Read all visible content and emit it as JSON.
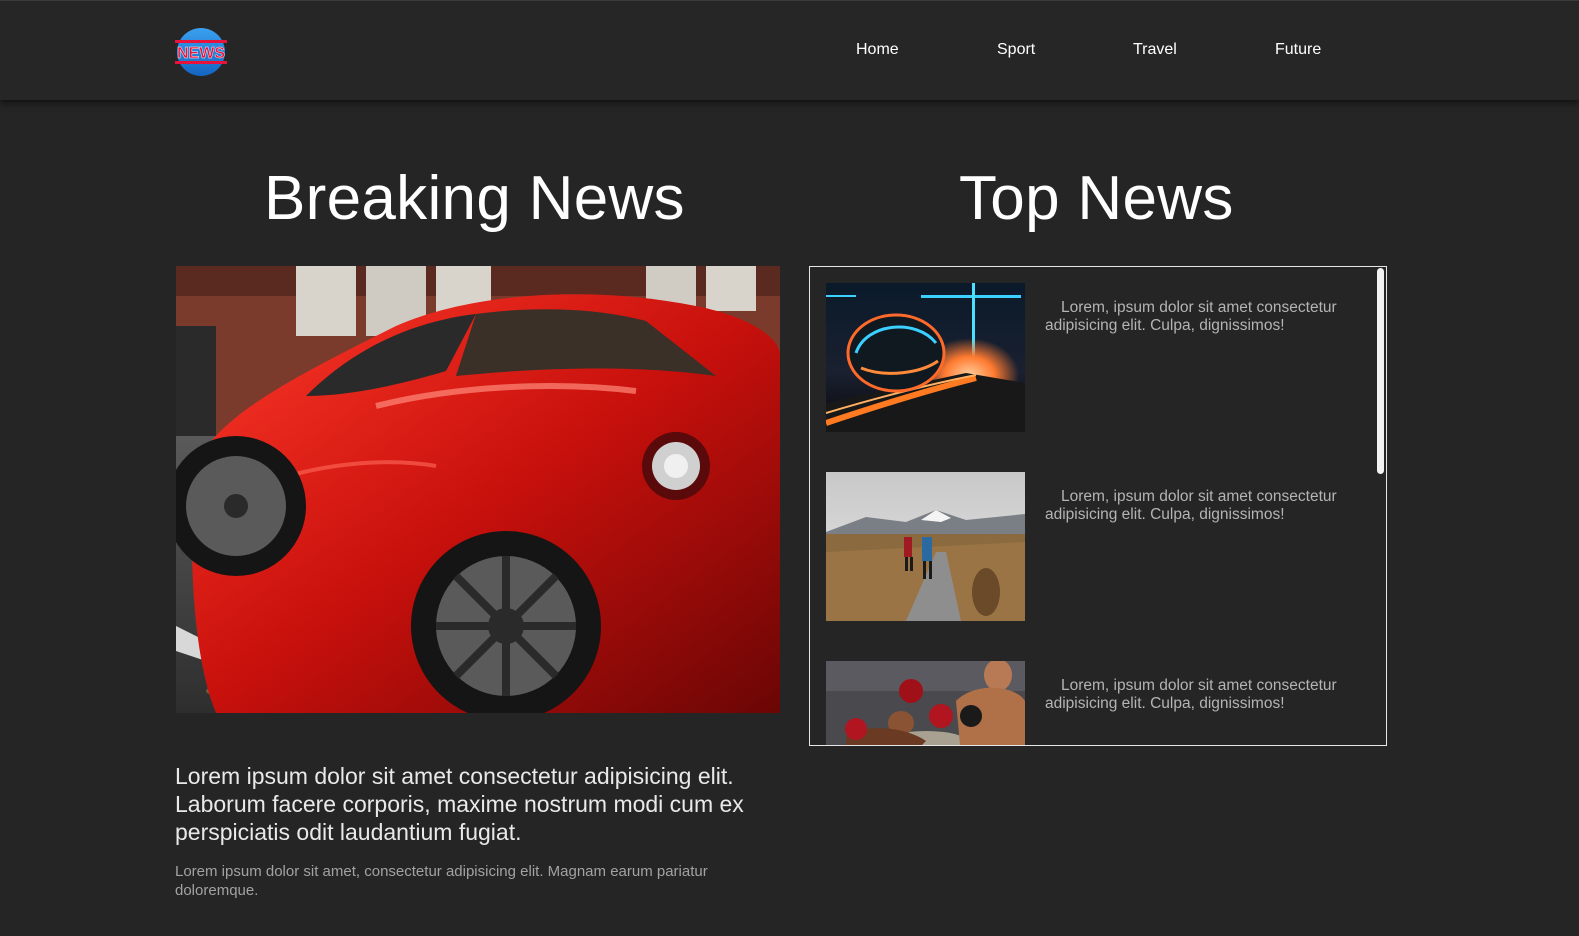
{
  "header": {
    "logo_text": "NEWS",
    "nav": [
      "Home",
      "Sport",
      "Travel",
      "Future"
    ]
  },
  "breaking": {
    "title": "Breaking News",
    "image": "red-sports-car-photo",
    "headline": "Lorem ipsum dolor sit amet consectetur adipisicing elit. Laborum facere corporis, maxime nostrum modi cum ex perspiciatis odit laudantium fugiat.",
    "summary": "Lorem ipsum dolor sit amet, consectetur adipisicing elit. Magnam earum pariatur doloremque."
  },
  "top": {
    "title": "Top News",
    "items": [
      {
        "image": "futuristic-car-photo",
        "text": "Lorem, ipsum dolor sit amet consectetur adipisicing elit. Culpa, dignissimos!"
      },
      {
        "image": "hikers-photo",
        "text": "Lorem, ipsum dolor sit amet consectetur adipisicing elit. Culpa, dignissimos!"
      },
      {
        "image": "boxing-photo",
        "text": "Lorem, ipsum dolor sit amet consectetur adipisicing elit. Culpa, dignissimos!"
      }
    ]
  },
  "colors": {
    "background": "#252525",
    "navbar": "#262626",
    "logo_red": "#e8123a",
    "logo_blue": "#1e88e5"
  }
}
